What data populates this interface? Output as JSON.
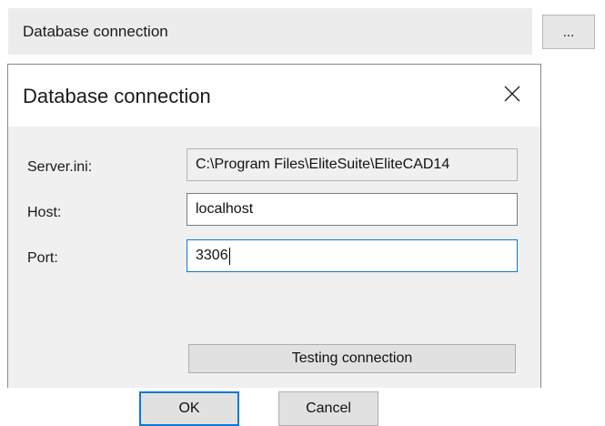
{
  "topbar": {
    "label": "Database connection",
    "more_button": "..."
  },
  "dialog": {
    "title": "Database connection",
    "close_glyph": "close-icon",
    "fields": [
      {
        "label": "Server.ini:",
        "value": "C:\\Program Files\\EliteSuite\\EliteCAD14",
        "readonly": true
      },
      {
        "label": "Host:",
        "value": "localhost",
        "readonly": false
      },
      {
        "label": "Port:",
        "value": "3306",
        "readonly": false,
        "focused": true
      }
    ],
    "test_button": "Testing connection",
    "ok_button": "OK",
    "cancel_button": "Cancel"
  },
  "colors": {
    "focus_accent": "#0a78d7",
    "dialog_body": "#f0f0f0",
    "topbar_bg": "#ececec"
  }
}
